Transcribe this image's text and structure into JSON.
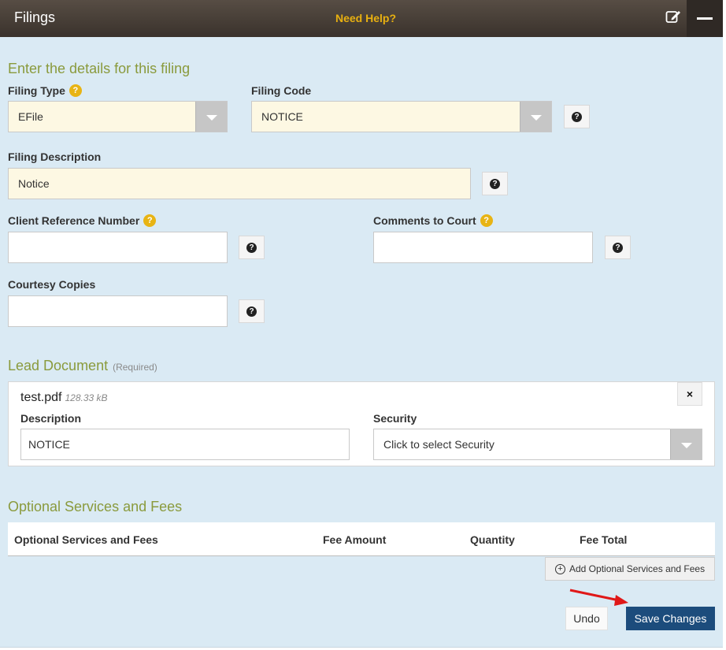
{
  "header": {
    "title": "Filings",
    "help": "Need Help?",
    "edit_icon": "edit-icon",
    "minimize_icon": "minimize-icon"
  },
  "details": {
    "section_title": "Enter the details for this filing",
    "filing_type": {
      "label": "Filing Type",
      "help": "?",
      "value": "EFile"
    },
    "filing_code": {
      "label": "Filing Code",
      "value": "NOTICE"
    },
    "filing_description": {
      "label": "Filing Description",
      "value": "Notice"
    },
    "client_reference": {
      "label": "Client Reference Number",
      "help": "?",
      "value": ""
    },
    "comments_to_court": {
      "label": "Comments to Court",
      "help": "?",
      "value": ""
    },
    "courtesy_copies": {
      "label": "Courtesy Copies",
      "value": ""
    }
  },
  "lead_document": {
    "section_title": "Lead Document",
    "required": "(Required)",
    "file_name": "test.pdf",
    "file_size": "128.33 kB",
    "remove_label": "×",
    "description_label": "Description",
    "description_value": "NOTICE",
    "security_label": "Security",
    "security_value": "Click to select Security"
  },
  "optional_services": {
    "section_title": "Optional Services and Fees",
    "columns": [
      "Optional Services and Fees",
      "Fee Amount",
      "Quantity",
      "Fee Total"
    ],
    "add_button": "Add Optional Services and Fees"
  },
  "actions": {
    "undo": "Undo",
    "save": "Save Changes"
  },
  "colors": {
    "accent_green": "#8a9a3c",
    "help_yellow": "#e8b414",
    "save_blue": "#1c4c7c",
    "panel_bg": "#daeaf4"
  }
}
